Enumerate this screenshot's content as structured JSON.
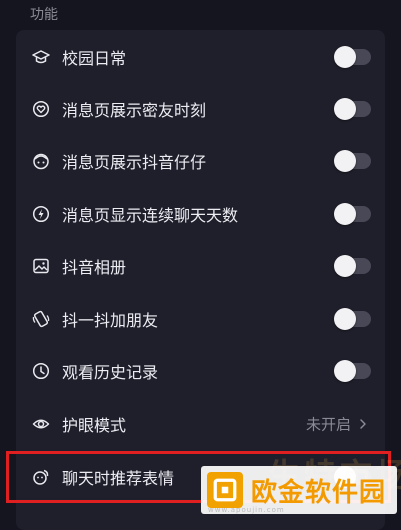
{
  "section": {
    "title": "功能"
  },
  "rows": [
    {
      "label": "校园日常",
      "icon": "graduation-cap-icon",
      "control": "toggle",
      "on": false
    },
    {
      "label": "消息页展示密友时刻",
      "icon": "heart-circle-icon",
      "control": "toggle",
      "on": false
    },
    {
      "label": "消息页展示抖音仔仔",
      "icon": "avatar-face-icon",
      "control": "toggle",
      "on": false
    },
    {
      "label": "消息页显示连续聊天天数",
      "icon": "lightning-circle-icon",
      "control": "toggle",
      "on": false
    },
    {
      "label": "抖音相册",
      "icon": "photo-album-icon",
      "control": "toggle",
      "on": false
    },
    {
      "label": "抖一抖加朋友",
      "icon": "phone-shake-icon",
      "control": "toggle",
      "on": false
    },
    {
      "label": "观看历史记录",
      "icon": "clock-icon",
      "control": "toggle",
      "on": false
    },
    {
      "label": "护眼模式",
      "icon": "eye-icon",
      "control": "value",
      "value": "未开启"
    },
    {
      "label": "聊天时推荐表情",
      "icon": "emoji-suggest-icon",
      "control": "toggle",
      "on": false
    }
  ],
  "watermark": {
    "text": "欧金软件园",
    "sub": "www.apoujin.com",
    "ghost": "生特市场"
  },
  "colors": {
    "background": "#15151f",
    "card": "#1f1f2b",
    "highlight": "#e02020",
    "watermark": "#f29a00"
  }
}
